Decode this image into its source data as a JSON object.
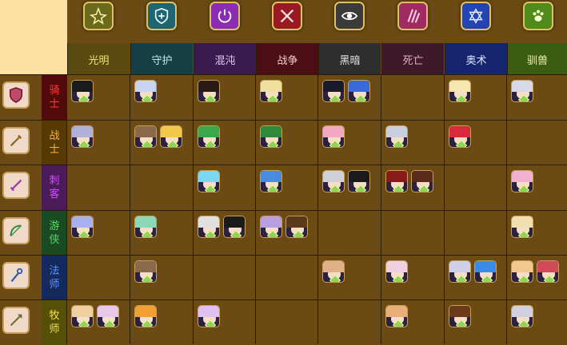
{
  "factions": [
    {
      "name": "光明",
      "bg": "#5a4a12",
      "fg": "#f2e27a",
      "badge": "#6b6a1a",
      "icon": "light-icon"
    },
    {
      "name": "守护",
      "bg": "#163f45",
      "fg": "#bfe8ef",
      "badge": "#1f6570",
      "icon": "shield-icon"
    },
    {
      "name": "混沌",
      "bg": "#3b1a4d",
      "fg": "#e2c9f0",
      "badge": "#8a2db3",
      "icon": "power-icon"
    },
    {
      "name": "战争",
      "bg": "#4a0e14",
      "fg": "#f2cacf",
      "badge": "#9a1a24",
      "icon": "crossed-swords-icon"
    },
    {
      "name": "黑暗",
      "bg": "#2e2e2e",
      "fg": "#e4e4e4",
      "badge": "#3a3a3a",
      "icon": "eye-icon"
    },
    {
      "name": "死亡",
      "bg": "#3d1a2a",
      "fg": "#e8a8c0",
      "badge": "#a02a62",
      "icon": "claw-marks-icon"
    },
    {
      "name": "奥术",
      "bg": "#15256e",
      "fg": "#dbe3ff",
      "badge": "#2344b2",
      "icon": "hexagram-icon"
    },
    {
      "name": "驯兽",
      "bg": "#3a5c13",
      "fg": "#eef3b0",
      "badge": "#4f8a1a",
      "icon": "paw-icon"
    }
  ],
  "classes": [
    {
      "name": [
        "骑",
        "士"
      ],
      "bg": "#520a0a",
      "fg": "#ff3a3a",
      "icon": "knight-shield-icon"
    },
    {
      "name": [
        "战",
        "士"
      ],
      "bg": "#553a06",
      "fg": "#ffb23a",
      "icon": "sword-icon"
    },
    {
      "name": [
        "刺",
        "客"
      ],
      "bg": "#4a1c5a",
      "fg": "#d44cff",
      "icon": "dagger-icon"
    },
    {
      "name": [
        "游",
        "侠"
      ],
      "bg": "#1a4a22",
      "fg": "#5ad66a",
      "icon": "bow-icon"
    },
    {
      "name": [
        "法",
        "师"
      ],
      "bg": "#142a5e",
      "fg": "#5a94ff",
      "icon": "staff-icon"
    },
    {
      "name": [
        "牧",
        "师"
      ],
      "bg": "#554f08",
      "fg": "#f2e24a",
      "icon": "spear-icon"
    }
  ],
  "heroes": [
    {
      "row": 0,
      "col": 0,
      "hair": "#1a1a1a"
    },
    {
      "row": 0,
      "col": 1,
      "hair": "#c8d4f0"
    },
    {
      "row": 0,
      "col": 2,
      "hair": "#2a1a14"
    },
    {
      "row": 0,
      "col": 3,
      "hair": "#f0e0a0"
    },
    {
      "row": 0,
      "col": 4,
      "hair": "#1a1a2a"
    },
    {
      "row": 0,
      "col": 4,
      "hair": "#3a6ad8"
    },
    {
      "row": 0,
      "col": 6,
      "hair": "#f6e6b0"
    },
    {
      "row": 0,
      "col": 7,
      "hair": "#d8d8e8"
    },
    {
      "row": 1,
      "col": 0,
      "hair": "#b0b0d8"
    },
    {
      "row": 1,
      "col": 1,
      "hair": "#8a6a4a"
    },
    {
      "row": 1,
      "col": 1,
      "hair": "#f2c84a"
    },
    {
      "row": 1,
      "col": 2,
      "hair": "#3aa84a"
    },
    {
      "row": 1,
      "col": 3,
      "hair": "#2e8a3a"
    },
    {
      "row": 1,
      "col": 4,
      "hair": "#f2a8c0"
    },
    {
      "row": 1,
      "col": 5,
      "hair": "#c8d0e0"
    },
    {
      "row": 1,
      "col": 6,
      "hair": "#d82a3a"
    },
    {
      "row": 2,
      "col": 2,
      "hair": "#7ad8f0"
    },
    {
      "row": 2,
      "col": 3,
      "hair": "#4a8ae0"
    },
    {
      "row": 2,
      "col": 4,
      "hair": "#d0d0d8"
    },
    {
      "row": 2,
      "col": 4,
      "hair": "#1a1a1a"
    },
    {
      "row": 2,
      "col": 5,
      "hair": "#8a1a1a"
    },
    {
      "row": 2,
      "col": 5,
      "hair": "#5a2a1a"
    },
    {
      "row": 2,
      "col": 7,
      "hair": "#f2b0d0"
    },
    {
      "row": 3,
      "col": 0,
      "hair": "#a8b0f0"
    },
    {
      "row": 3,
      "col": 1,
      "hair": "#8ad8b8"
    },
    {
      "row": 3,
      "col": 2,
      "hair": "#e0e0e0"
    },
    {
      "row": 3,
      "col": 2,
      "hair": "#1a1a1a"
    },
    {
      "row": 3,
      "col": 3,
      "hair": "#b8a0e0"
    },
    {
      "row": 3,
      "col": 3,
      "hair": "#5a3a1a"
    },
    {
      "row": 3,
      "col": 7,
      "hair": "#f0e0b0"
    },
    {
      "row": 4,
      "col": 1,
      "hair": "#8a6a4a"
    },
    {
      "row": 4,
      "col": 4,
      "hair": "#e0b088"
    },
    {
      "row": 4,
      "col": 5,
      "hair": "#f0d0e0"
    },
    {
      "row": 4,
      "col": 6,
      "hair": "#d0d0e8"
    },
    {
      "row": 4,
      "col": 6,
      "hair": "#3a8ae8"
    },
    {
      "row": 4,
      "col": 7,
      "hair": "#f2c890"
    },
    {
      "row": 4,
      "col": 7,
      "hair": "#d04a5a"
    },
    {
      "row": 5,
      "col": 0,
      "hair": "#f0d0a0"
    },
    {
      "row": 5,
      "col": 0,
      "hair": "#e8c8e8"
    },
    {
      "row": 5,
      "col": 1,
      "hair": "#f2a030"
    },
    {
      "row": 5,
      "col": 2,
      "hair": "#e0c0f0"
    },
    {
      "row": 5,
      "col": 5,
      "hair": "#e8b078"
    },
    {
      "row": 5,
      "col": 6,
      "hair": "#6a3a1a"
    },
    {
      "row": 5,
      "col": 7,
      "hair": "#d0d0e0"
    }
  ]
}
